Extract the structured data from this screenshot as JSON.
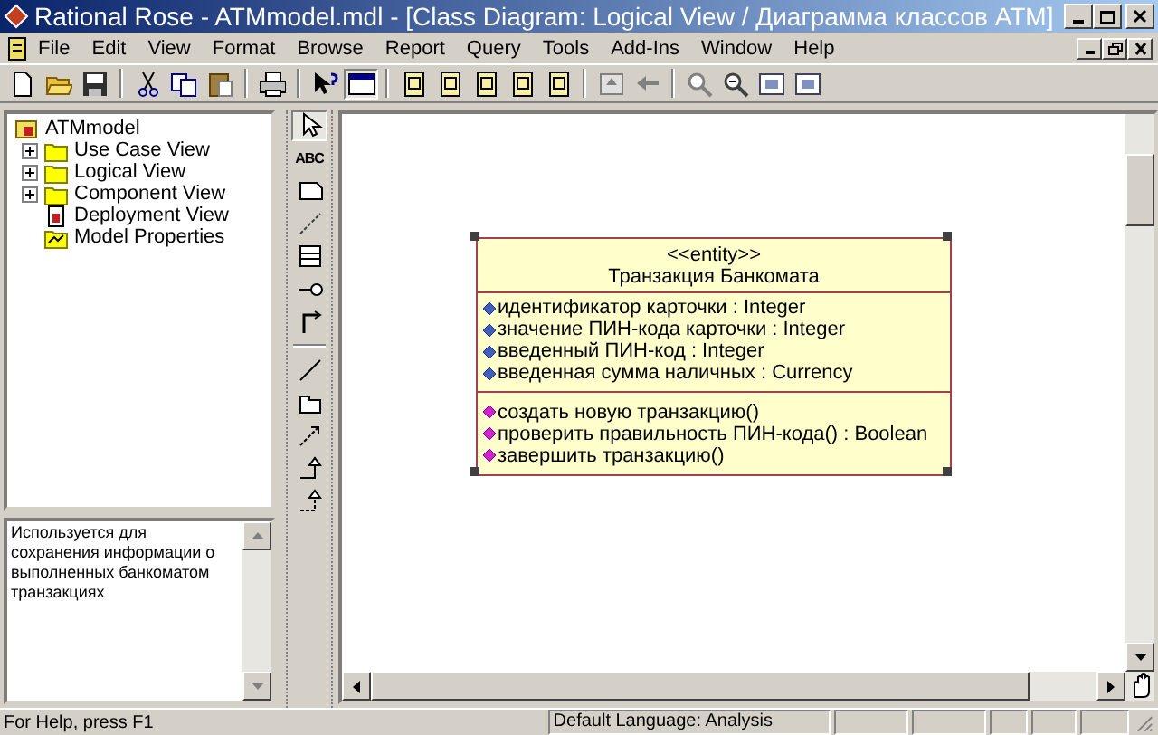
{
  "window": {
    "title": "Rational Rose - ATMmodel.mdl - [Class Diagram: Logical View / Диаграмма классов ATM]"
  },
  "menu": [
    "File",
    "Edit",
    "View",
    "Format",
    "Browse",
    "Report",
    "Query",
    "Tools",
    "Add-Ins",
    "Window",
    "Help"
  ],
  "toolbar": [
    {
      "kind": "new",
      "selected": false
    },
    {
      "kind": "open",
      "selected": false
    },
    {
      "kind": "save",
      "selected": false
    },
    {
      "kind": "sep"
    },
    {
      "kind": "cut",
      "selected": false
    },
    {
      "kind": "copy",
      "selected": false
    },
    {
      "kind": "paste",
      "selected": false
    },
    {
      "kind": "sep"
    },
    {
      "kind": "print",
      "selected": false
    },
    {
      "kind": "sep"
    },
    {
      "kind": "helppointer",
      "selected": false
    },
    {
      "kind": "window",
      "selected": true
    },
    {
      "kind": "sep"
    },
    {
      "kind": "doc",
      "selected": false
    },
    {
      "kind": "doc",
      "selected": false
    },
    {
      "kind": "doc",
      "selected": false
    },
    {
      "kind": "doc",
      "selected": false
    },
    {
      "kind": "doc",
      "selected": false
    },
    {
      "kind": "sep"
    },
    {
      "kind": "up",
      "selected": false
    },
    {
      "kind": "back",
      "selected": false
    },
    {
      "kind": "sep"
    },
    {
      "kind": "zoomin",
      "selected": false
    },
    {
      "kind": "zoomout",
      "selected": false
    },
    {
      "kind": "fit",
      "selected": false
    },
    {
      "kind": "fit",
      "selected": false
    }
  ],
  "tree": {
    "label": "ATMmodel",
    "kind": "model",
    "expanded": true,
    "children": [
      {
        "label": "Use Case View",
        "kind": "folder",
        "expanded": false
      },
      {
        "label": "Logical View",
        "kind": "folder",
        "expanded": false
      },
      {
        "label": "Component View",
        "kind": "folder",
        "expanded": false
      },
      {
        "label": "Deployment View",
        "kind": "deployment"
      },
      {
        "label": "Model Properties",
        "kind": "properties"
      }
    ]
  },
  "documentation": "Используется для сохранения информации о выполненных банкоматом транзакциях",
  "toolbox": [
    {
      "kind": "arrow",
      "selected": true
    },
    {
      "kind": "text",
      "label": "ABC",
      "selected": false
    },
    {
      "kind": "note",
      "selected": false
    },
    {
      "kind": "anchor",
      "selected": false
    },
    {
      "kind": "class",
      "selected": false
    },
    {
      "kind": "interface",
      "selected": false
    },
    {
      "kind": "assoc",
      "selected": false
    },
    {
      "kind": "sep"
    },
    {
      "kind": "line",
      "selected": false
    },
    {
      "kind": "package",
      "selected": false
    },
    {
      "kind": "depend",
      "selected": false
    },
    {
      "kind": "general",
      "selected": false
    },
    {
      "kind": "realize",
      "selected": false
    }
  ],
  "class": {
    "stereotype": "<<entity>>",
    "name": "Транзакция Банкомата",
    "selected": true,
    "attributes": [
      "идентификатор карточки : Integer",
      "значение ПИН-кода карточки : Integer",
      "введенный ПИН-код : Integer",
      "введенная сумма наличных : Currency"
    ],
    "operations": [
      "создать новую транзакцию()",
      "проверить правильность ПИН-кода() : Boolean",
      "завершить транзакцию()"
    ]
  },
  "status_bar": {
    "help": "For Help, press F1",
    "language": "Default Language: Analysis"
  }
}
